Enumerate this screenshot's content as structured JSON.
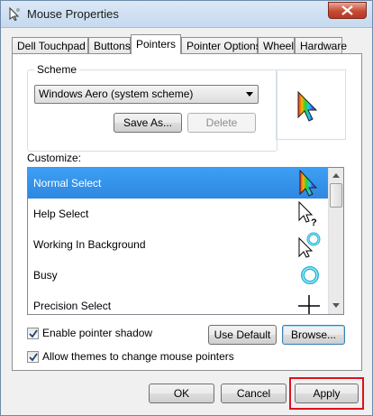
{
  "window": {
    "title": "Mouse Properties",
    "icon": "mouse-properties-icon"
  },
  "tabs": [
    {
      "label": "Dell Touchpad"
    },
    {
      "label": "Buttons"
    },
    {
      "label": "Pointers",
      "active": true
    },
    {
      "label": "Pointer Options"
    },
    {
      "label": "Wheel"
    },
    {
      "label": "Hardware"
    }
  ],
  "scheme": {
    "group_label": "Scheme",
    "selected": "Windows Aero (system scheme)",
    "save_as_label": "Save As...",
    "delete_label": "Delete"
  },
  "customize": {
    "label": "Customize:",
    "items": [
      {
        "label": "Normal Select",
        "icon": "rainbow-arrow-cursor-icon",
        "selected": true
      },
      {
        "label": "Help Select",
        "icon": "help-cursor-icon"
      },
      {
        "label": "Working In Background",
        "icon": "working-cursor-icon"
      },
      {
        "label": "Busy",
        "icon": "busy-ring-icon"
      },
      {
        "label": "Precision Select",
        "icon": "crosshair-icon"
      }
    ]
  },
  "options": {
    "enable_shadow_label": "Enable pointer shadow",
    "enable_shadow_checked": true,
    "allow_themes_label": "Allow themes to change mouse pointers",
    "allow_themes_checked": true,
    "use_default_label": "Use Default",
    "browse_label": "Browse..."
  },
  "footer": {
    "ok_label": "OK",
    "cancel_label": "Cancel",
    "apply_label": "Apply"
  },
  "colors": {
    "selection": "#3399ff",
    "highlight_frame": "#e0101c"
  }
}
